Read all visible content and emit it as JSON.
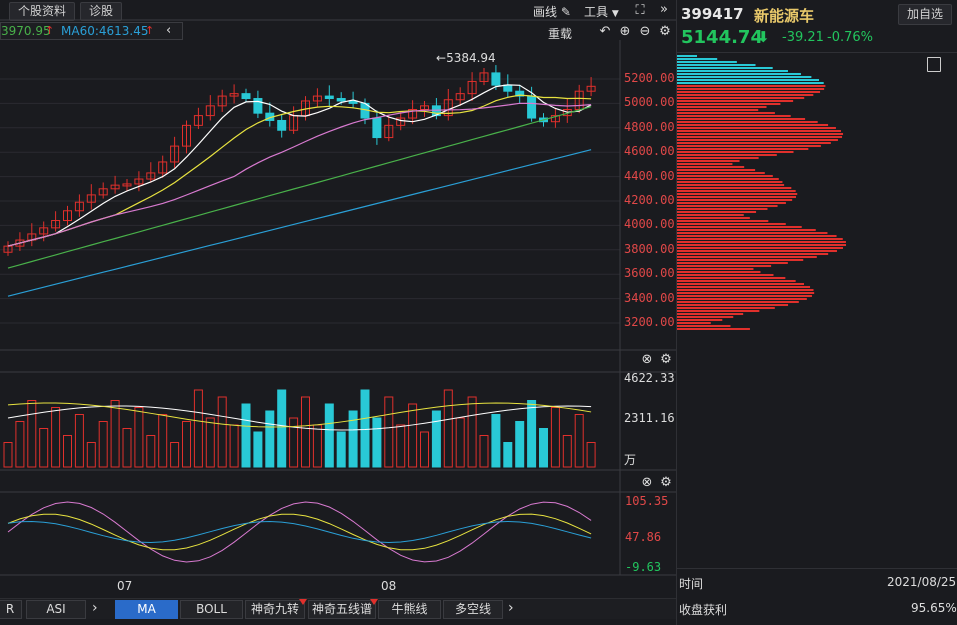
{
  "toolbar": {
    "tab_profile": "个股资料",
    "tab_diagnose": "诊股",
    "draw_label": "画线",
    "tools_label": "工具",
    "reload_label": "重载"
  },
  "ma_legend": {
    "ma_partial": "3970.95",
    "ma60": "MA60:4613.45"
  },
  "price_chart": {
    "y_ticks": [
      "5200.00",
      "5000.00",
      "4800.00",
      "4600.00",
      "4400.00",
      "4200.00",
      "4000.00",
      "3800.00",
      "3600.00",
      "3400.00",
      "3200.00"
    ],
    "peak_label": "5384.94",
    "ma_colors": {
      "ma5": "#ffffff",
      "ma10": "#e8e340",
      "ma20": "#d87ad0",
      "ma30": "#49b14a",
      "ma60": "#2a9fd6"
    }
  },
  "volume_chart": {
    "y_ticks": [
      "4622.33",
      "2311.16"
    ],
    "unit": "万"
  },
  "indicator_chart": {
    "y_ticks": [
      "105.35",
      "47.86",
      "-9.63"
    ]
  },
  "x_axis": {
    "labels": [
      "07",
      "08"
    ]
  },
  "bottom_tabs": [
    "R",
    "ASI",
    "MA",
    "BOLL",
    "神奇九转",
    "神奇五线谱",
    "牛熊线",
    "多空线"
  ],
  "active_tab": "MA",
  "quote": {
    "code": "399417",
    "name": "新能源车",
    "add_watch": "加自选",
    "price": "5144.74",
    "change": "-39.21",
    "change_pct": "-0.76%"
  },
  "info": {
    "time_label": "时间",
    "time_value": "2021/08/25",
    "profit_label": "收盘获利",
    "profit_value": "95.65%"
  },
  "colors": {
    "up": "#e0302c",
    "down": "#29c9d6",
    "price_green": "#22c55e"
  }
}
